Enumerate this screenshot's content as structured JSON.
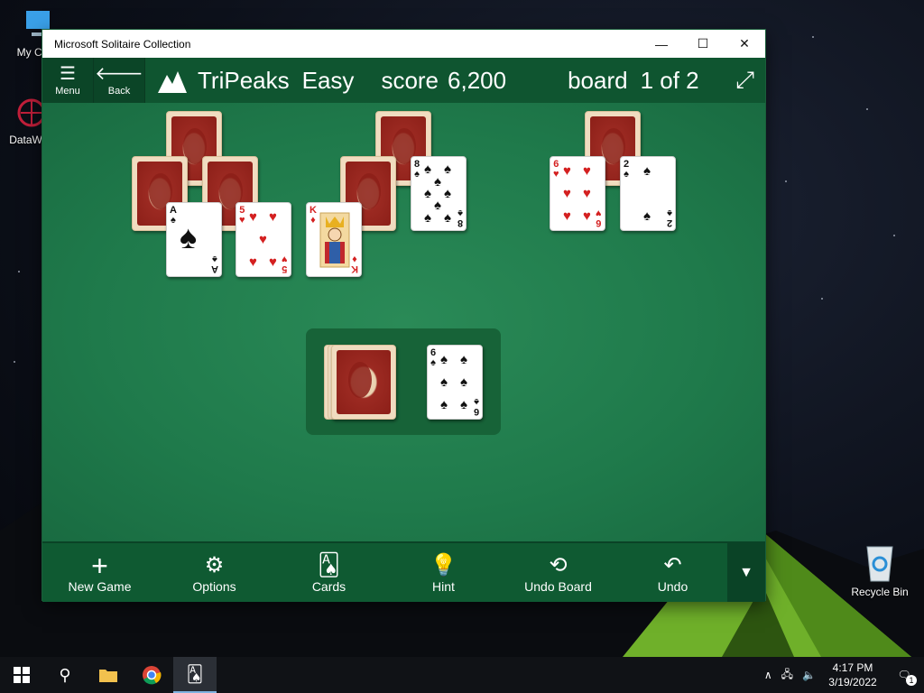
{
  "desktop": {
    "icons": [
      {
        "label": "My Com",
        "icon": "computer-icon"
      },
      {
        "label": "DataWag",
        "icon": "datawag-icon"
      },
      {
        "label": "Recycle Bin",
        "icon": "recycle-bin-icon"
      }
    ]
  },
  "window": {
    "title": "Microsoft Solitaire Collection",
    "controls": {
      "minimize": "—",
      "maximize": "☐",
      "close": "✕"
    }
  },
  "header": {
    "menu_label": "Menu",
    "back_label": "Back",
    "game": "TriPeaks",
    "difficulty": "Easy",
    "score_label": "score",
    "score_value": "6,200",
    "board_label": "board",
    "board_value": "1 of 2"
  },
  "cards": {
    "ace_spades": {
      "rank": "A",
      "suit": "♠"
    },
    "five_hearts": {
      "rank": "5",
      "suit": "♥"
    },
    "king_diamonds": {
      "rank": "K",
      "suit": "♦"
    },
    "eight_spades": {
      "rank": "8",
      "suit": "♠"
    },
    "six_hearts": {
      "rank": "6",
      "suit": "♥"
    },
    "two_spades": {
      "rank": "2",
      "suit": "♠"
    },
    "six_spades_waste": {
      "rank": "6",
      "suit": "♠"
    }
  },
  "toolbar": {
    "new_game": "New Game",
    "options": "Options",
    "cards": "Cards",
    "hint": "Hint",
    "undo_board": "Undo Board",
    "undo": "Undo"
  },
  "taskbar": {
    "time": "4:17 PM",
    "date": "3/19/2022",
    "notification_count": "1"
  },
  "colors": {
    "felt": "#1f7a4b",
    "header": "#0f5530",
    "toolbar": "#0f5a32",
    "card_red": "#d42020"
  }
}
